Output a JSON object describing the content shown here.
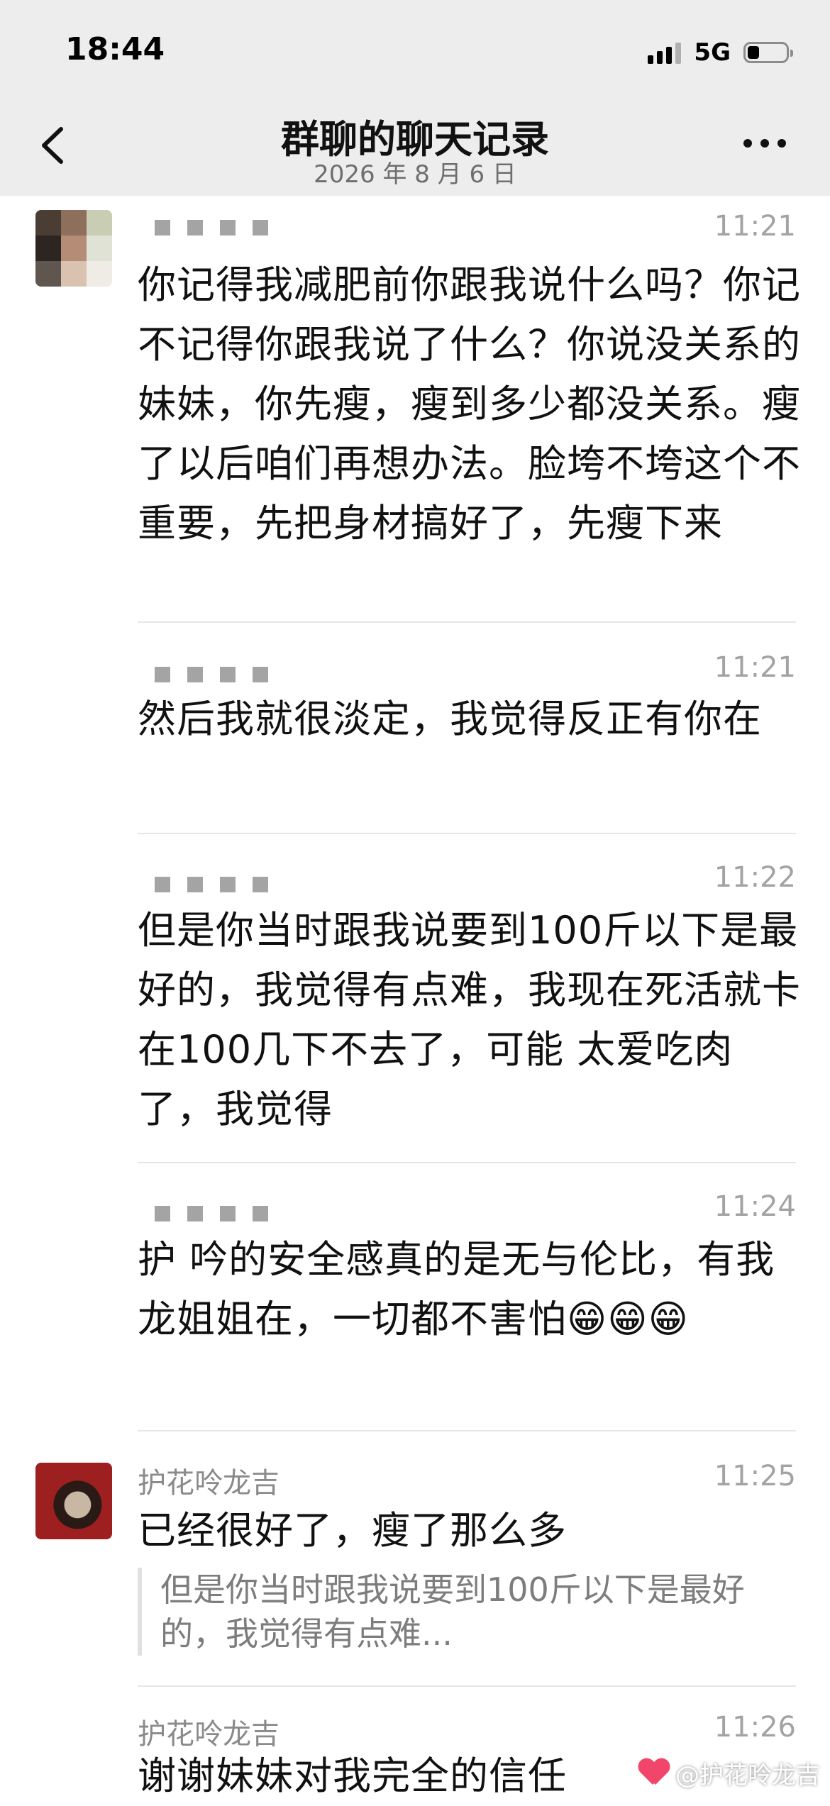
{
  "status_bar": {
    "time": "18:44",
    "network": "5G"
  },
  "header": {
    "title": "群聊的聊天记录",
    "date": "2026 年 8 月 6 日"
  },
  "messages": [
    {
      "sender": "",
      "time": "11:21",
      "text": "你记得我减肥前你跟我说什么吗？你记不记得你跟我说了什么？你说没关系的妹妹，你先瘦，瘦到多少都没关系。瘦了以后咱们再想办法。脸垮不垮这个不重要，先把身材搞好了，先瘦下来"
    },
    {
      "sender": "",
      "time": "11:21",
      "text": "然后我就很淡定，我觉得反正有你在"
    },
    {
      "sender": "",
      "time": "11:22",
      "text": "但是你当时跟我说要到100斤以下是最好的，我觉得有点难，我现在死活就卡在100几下不去了，可能 太爱吃肉了，我觉得"
    },
    {
      "sender": "",
      "time": "11:24",
      "text": "护 吟的安全感真的是无与伦比，有我龙姐姐在，一切都不害怕😁😁😁"
    },
    {
      "sender": "护花呤龙吉",
      "time": "11:25",
      "text": "已经很好了，瘦了那么多",
      "quote": "但是你当时跟我说要到100斤以下是最好的，我觉得有点难..."
    },
    {
      "sender": "护花呤龙吉",
      "time": "11:26",
      "text": "谢谢妹妹对我完全的信任"
    }
  ],
  "watermark": "@护花呤龙吉",
  "icons": {
    "back": "chevron-left-icon",
    "more": "more-icon",
    "signal": "signal-icon",
    "battery": "battery-icon",
    "heart": "heart-icon"
  },
  "colors": {
    "header_bg": "#ededed",
    "sender_gray": "#8a8a8a",
    "time_gray": "#a3a3a3",
    "heart": "#f2456b"
  }
}
